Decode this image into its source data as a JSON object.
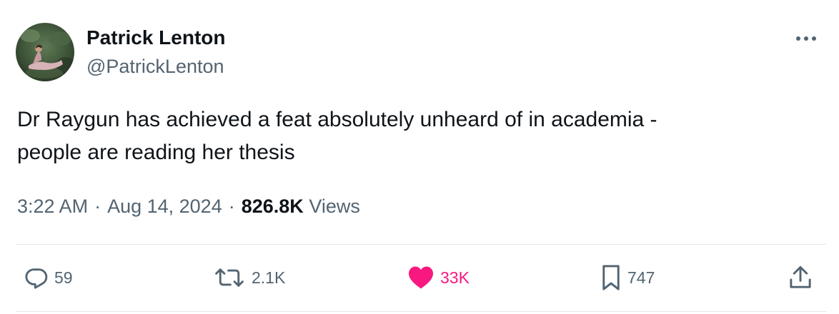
{
  "author": {
    "display_name": "Patrick Lenton",
    "handle": "@PatrickLenton"
  },
  "tweet": {
    "text_lines": [
      "Dr Raygun has achieved a feat absolutely unheard of in academia -",
      "people are reading her thesis"
    ]
  },
  "meta": {
    "time": "3:22 AM",
    "separator": "·",
    "date": "Aug 14, 2024",
    "views_count": "826.8K",
    "views_label": "Views"
  },
  "actions": {
    "replies": "59",
    "reposts": "2.1K",
    "likes": "33K",
    "bookmarks": "747"
  },
  "colors": {
    "text_primary": "#0f1419",
    "text_secondary": "#536471",
    "like_active": "#f91880",
    "divider": "#e1e8ed"
  },
  "icons": {
    "more": "more-dots-icon",
    "reply": "reply-bubble-icon",
    "repost": "repost-arrows-icon",
    "like": "heart-filled-icon",
    "bookmark": "bookmark-icon",
    "share": "share-upload-icon"
  }
}
